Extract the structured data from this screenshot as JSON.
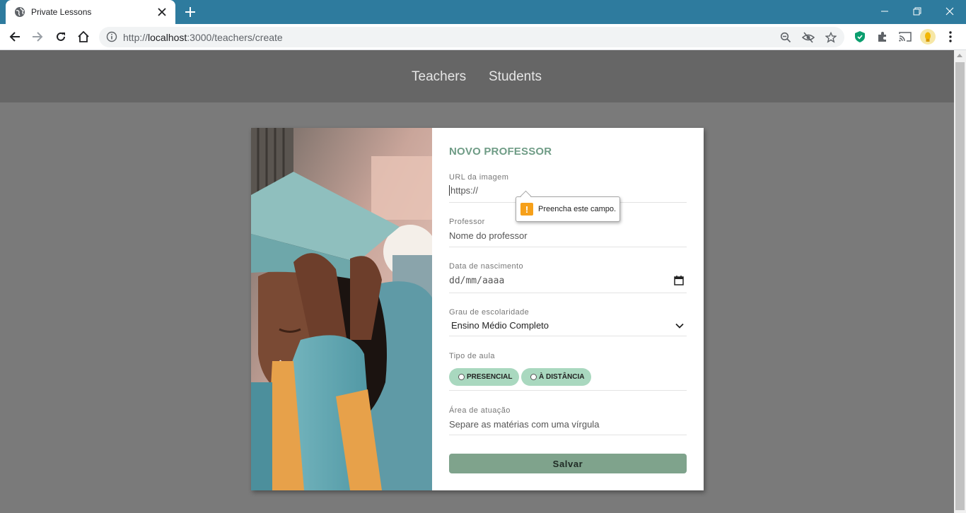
{
  "browser": {
    "tab_title": "Private Lessons",
    "url_prefix": "http://",
    "url_host": "localhost",
    "url_path": ":3000/teachers/create"
  },
  "nav": {
    "teachers": "Teachers",
    "students": "Students"
  },
  "form": {
    "title": "NOVO PROFESSOR",
    "avatar_url": {
      "label": "URL da imagem",
      "placeholder": "https://"
    },
    "name": {
      "label": "Professor",
      "placeholder": "Nome do professor"
    },
    "birth": {
      "label": "Data de nascimento",
      "placeholder": "dd/mm/aaaa"
    },
    "education": {
      "label": "Grau de escolaridade",
      "selected": "Ensino Médio Completo"
    },
    "class_type": {
      "label": "Tipo de aula",
      "options": [
        "PRESENCIAL",
        "À DISTÂNCIA"
      ]
    },
    "subjects": {
      "label": "Área de atuação",
      "placeholder": "Separe as matérias com uma vírgula"
    },
    "save_label": "Salvar"
  },
  "validation": {
    "message": "Preencha este campo.",
    "icon": "!"
  },
  "colors": {
    "accent": "#6f9c86",
    "pill": "#a9d8bf",
    "button": "#7fa38c",
    "tab_strip": "#2e7b9e",
    "header": "#666666",
    "page_bg": "#7a7a7a"
  }
}
